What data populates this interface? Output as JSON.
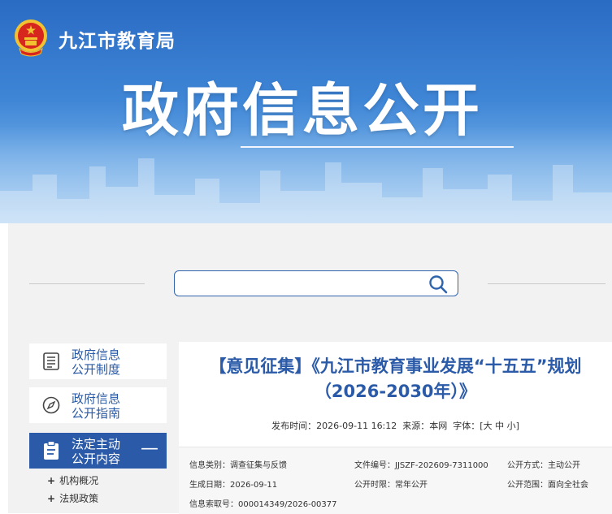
{
  "header": {
    "org_name": "九江市教育局",
    "banner_title": "政府信息公开"
  },
  "search": {
    "placeholder": "",
    "value": ""
  },
  "sidebar": {
    "items": [
      {
        "label_line1": "政府信息",
        "label_line2": "公开制度",
        "icon": "document-list-icon"
      },
      {
        "label_line1": "政府信息",
        "label_line2": "公开指南",
        "icon": "compass-icon"
      },
      {
        "label_line1": "法定主动",
        "label_line2": "公开内容",
        "icon": "clipboard-icon",
        "expanded": true,
        "toggle": "—"
      }
    ],
    "sub_items": [
      {
        "marker": "+",
        "label": "机构概况"
      },
      {
        "marker": "+",
        "label": "法规政策"
      }
    ]
  },
  "article": {
    "title_line1": "【意见征集】《九江市教育事业发展“十五五”规划",
    "title_line2": "（2026-2030年）》",
    "meta": {
      "publish_label": "发布时间：",
      "publish_time": "2026-09-11 16:12",
      "source_label": "来源：",
      "source": "本网",
      "font_label": "字体：",
      "font_open": "[",
      "font_large": "大",
      "font_medium": "中",
      "font_small": "小",
      "font_close": "]"
    },
    "info": {
      "category_label": "信息类别：",
      "category": "调查征集与反馈",
      "doc_no_label": "文件编号：",
      "doc_no": "JJSZF-202609-7311000",
      "open_method_label": "公开方式：",
      "open_method": "主动公开",
      "date_label": "生成日期：",
      "date": "2026-09-11",
      "open_period_label": "公开时限：",
      "open_period": "常年公开",
      "open_scope_label": "公开范围：",
      "open_scope": "面向全社会",
      "index_label": "信息索取号：",
      "index_no": "000014349/2026-00377"
    }
  },
  "colors": {
    "brand_blue": "#2b5ba8",
    "banner_blue": "#3f86d6",
    "emblem_red": "#d7261e",
    "emblem_gold": "#f2c230"
  }
}
